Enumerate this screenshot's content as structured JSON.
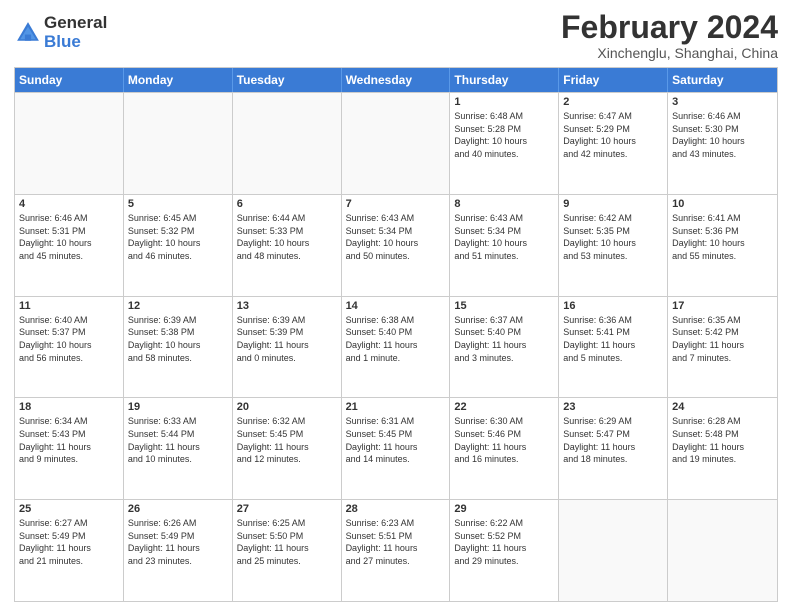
{
  "logo": {
    "general": "General",
    "blue": "Blue"
  },
  "title": {
    "month_year": "February 2024",
    "location": "Xinchenglu, Shanghai, China"
  },
  "header_days": [
    "Sunday",
    "Monday",
    "Tuesday",
    "Wednesday",
    "Thursday",
    "Friday",
    "Saturday"
  ],
  "weeks": [
    [
      {
        "day": "",
        "info": ""
      },
      {
        "day": "",
        "info": ""
      },
      {
        "day": "",
        "info": ""
      },
      {
        "day": "",
        "info": ""
      },
      {
        "day": "1",
        "info": "Sunrise: 6:48 AM\nSunset: 5:28 PM\nDaylight: 10 hours\nand 40 minutes."
      },
      {
        "day": "2",
        "info": "Sunrise: 6:47 AM\nSunset: 5:29 PM\nDaylight: 10 hours\nand 42 minutes."
      },
      {
        "day": "3",
        "info": "Sunrise: 6:46 AM\nSunset: 5:30 PM\nDaylight: 10 hours\nand 43 minutes."
      }
    ],
    [
      {
        "day": "4",
        "info": "Sunrise: 6:46 AM\nSunset: 5:31 PM\nDaylight: 10 hours\nand 45 minutes."
      },
      {
        "day": "5",
        "info": "Sunrise: 6:45 AM\nSunset: 5:32 PM\nDaylight: 10 hours\nand 46 minutes."
      },
      {
        "day": "6",
        "info": "Sunrise: 6:44 AM\nSunset: 5:33 PM\nDaylight: 10 hours\nand 48 minutes."
      },
      {
        "day": "7",
        "info": "Sunrise: 6:43 AM\nSunset: 5:34 PM\nDaylight: 10 hours\nand 50 minutes."
      },
      {
        "day": "8",
        "info": "Sunrise: 6:43 AM\nSunset: 5:34 PM\nDaylight: 10 hours\nand 51 minutes."
      },
      {
        "day": "9",
        "info": "Sunrise: 6:42 AM\nSunset: 5:35 PM\nDaylight: 10 hours\nand 53 minutes."
      },
      {
        "day": "10",
        "info": "Sunrise: 6:41 AM\nSunset: 5:36 PM\nDaylight: 10 hours\nand 55 minutes."
      }
    ],
    [
      {
        "day": "11",
        "info": "Sunrise: 6:40 AM\nSunset: 5:37 PM\nDaylight: 10 hours\nand 56 minutes."
      },
      {
        "day": "12",
        "info": "Sunrise: 6:39 AM\nSunset: 5:38 PM\nDaylight: 10 hours\nand 58 minutes."
      },
      {
        "day": "13",
        "info": "Sunrise: 6:39 AM\nSunset: 5:39 PM\nDaylight: 11 hours\nand 0 minutes."
      },
      {
        "day": "14",
        "info": "Sunrise: 6:38 AM\nSunset: 5:40 PM\nDaylight: 11 hours\nand 1 minute."
      },
      {
        "day": "15",
        "info": "Sunrise: 6:37 AM\nSunset: 5:40 PM\nDaylight: 11 hours\nand 3 minutes."
      },
      {
        "day": "16",
        "info": "Sunrise: 6:36 AM\nSunset: 5:41 PM\nDaylight: 11 hours\nand 5 minutes."
      },
      {
        "day": "17",
        "info": "Sunrise: 6:35 AM\nSunset: 5:42 PM\nDaylight: 11 hours\nand 7 minutes."
      }
    ],
    [
      {
        "day": "18",
        "info": "Sunrise: 6:34 AM\nSunset: 5:43 PM\nDaylight: 11 hours\nand 9 minutes."
      },
      {
        "day": "19",
        "info": "Sunrise: 6:33 AM\nSunset: 5:44 PM\nDaylight: 11 hours\nand 10 minutes."
      },
      {
        "day": "20",
        "info": "Sunrise: 6:32 AM\nSunset: 5:45 PM\nDaylight: 11 hours\nand 12 minutes."
      },
      {
        "day": "21",
        "info": "Sunrise: 6:31 AM\nSunset: 5:45 PM\nDaylight: 11 hours\nand 14 minutes."
      },
      {
        "day": "22",
        "info": "Sunrise: 6:30 AM\nSunset: 5:46 PM\nDaylight: 11 hours\nand 16 minutes."
      },
      {
        "day": "23",
        "info": "Sunrise: 6:29 AM\nSunset: 5:47 PM\nDaylight: 11 hours\nand 18 minutes."
      },
      {
        "day": "24",
        "info": "Sunrise: 6:28 AM\nSunset: 5:48 PM\nDaylight: 11 hours\nand 19 minutes."
      }
    ],
    [
      {
        "day": "25",
        "info": "Sunrise: 6:27 AM\nSunset: 5:49 PM\nDaylight: 11 hours\nand 21 minutes."
      },
      {
        "day": "26",
        "info": "Sunrise: 6:26 AM\nSunset: 5:49 PM\nDaylight: 11 hours\nand 23 minutes."
      },
      {
        "day": "27",
        "info": "Sunrise: 6:25 AM\nSunset: 5:50 PM\nDaylight: 11 hours\nand 25 minutes."
      },
      {
        "day": "28",
        "info": "Sunrise: 6:23 AM\nSunset: 5:51 PM\nDaylight: 11 hours\nand 27 minutes."
      },
      {
        "day": "29",
        "info": "Sunrise: 6:22 AM\nSunset: 5:52 PM\nDaylight: 11 hours\nand 29 minutes."
      },
      {
        "day": "",
        "info": ""
      },
      {
        "day": "",
        "info": ""
      }
    ]
  ]
}
